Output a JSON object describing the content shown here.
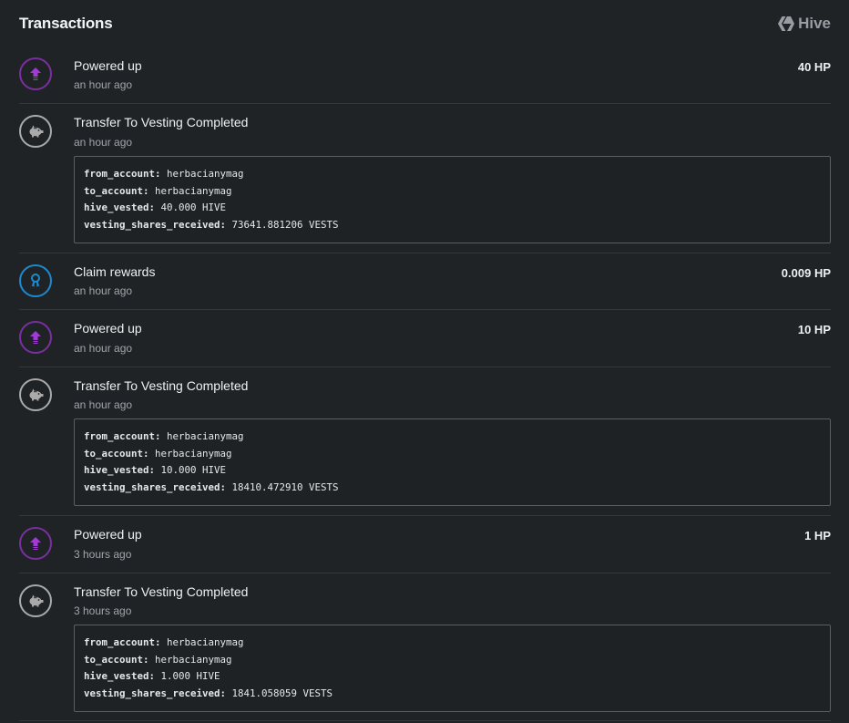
{
  "header": {
    "title": "Transactions",
    "brand": "Hive"
  },
  "transactions": [
    {
      "type": "power_up",
      "icon": "power-up-icon",
      "title": "Powered up",
      "time": "an hour ago",
      "amount": "40 HP"
    },
    {
      "type": "transfer_to_vesting",
      "icon": "piggy-bank-icon",
      "title": "Transfer To Vesting Completed",
      "time": "an hour ago",
      "details": {
        "from_account_key": "from_account:",
        "from_account": "herbacianymag",
        "to_account_key": "to_account:",
        "to_account": "herbacianymag",
        "hive_vested_key": "hive_vested:",
        "hive_vested": "40.000 HIVE",
        "vesting_shares_received_key": "vesting_shares_received:",
        "vesting_shares_received": "73641.881206 VESTS"
      }
    },
    {
      "type": "claim_rewards",
      "icon": "award-ribbon-icon",
      "title": "Claim rewards",
      "time": "an hour ago",
      "amount": "0.009 HP"
    },
    {
      "type": "power_up",
      "icon": "power-up-icon",
      "title": "Powered up",
      "time": "an hour ago",
      "amount": "10 HP"
    },
    {
      "type": "transfer_to_vesting",
      "icon": "piggy-bank-icon",
      "title": "Transfer To Vesting Completed",
      "time": "an hour ago",
      "details": {
        "from_account_key": "from_account:",
        "from_account": "herbacianymag",
        "to_account_key": "to_account:",
        "to_account": "herbacianymag",
        "hive_vested_key": "hive_vested:",
        "hive_vested": "10.000 HIVE",
        "vesting_shares_received_key": "vesting_shares_received:",
        "vesting_shares_received": "18410.472910 VESTS"
      }
    },
    {
      "type": "power_up",
      "icon": "power-up-icon",
      "title": "Powered up",
      "time": "3 hours ago",
      "amount": "1 HP"
    },
    {
      "type": "transfer_to_vesting",
      "icon": "piggy-bank-icon",
      "title": "Transfer To Vesting Completed",
      "time": "3 hours ago",
      "details": {
        "from_account_key": "from_account:",
        "from_account": "herbacianymag",
        "to_account_key": "to_account:",
        "to_account": "herbacianymag",
        "hive_vested_key": "hive_vested:",
        "hive_vested": "1.000 HIVE",
        "vesting_shares_received_key": "vesting_shares_received:",
        "vesting_shares_received": "1841.058059 VESTS"
      }
    }
  ],
  "colors": {
    "background": "#202326",
    "power_up_ring": "#7a2fa0",
    "power_up_arrow": "#a33ad6",
    "vesting_ring": "#aaaaaa",
    "claim_ring": "#1b8ad0"
  }
}
